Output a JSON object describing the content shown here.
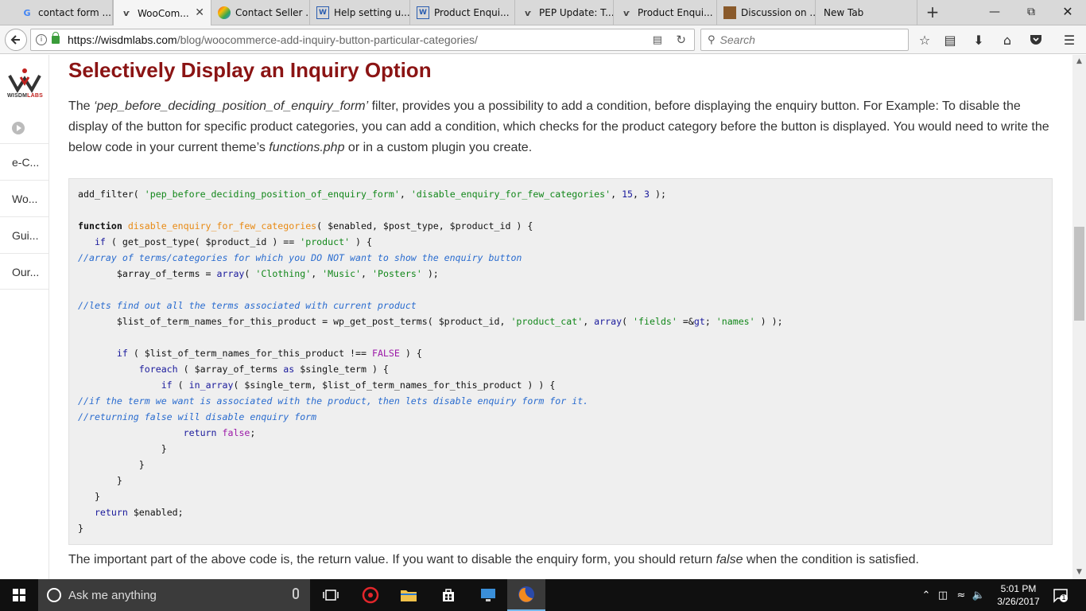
{
  "browser": {
    "tabs": [
      {
        "title": "contact form ...",
        "favicon": "google-icon"
      },
      {
        "title": "WooCom...",
        "favicon": "wisdmlabs-icon",
        "active": true
      },
      {
        "title": "Contact Seller ...",
        "favicon": "multicolor-icon"
      },
      {
        "title": "Help setting u...",
        "favicon": "wp-icon"
      },
      {
        "title": "Product Enqui...",
        "favicon": "wp-icon"
      },
      {
        "title": "PEP Update: T...",
        "favicon": "wisdmlabs-icon"
      },
      {
        "title": "Product Enqui...",
        "favicon": "wisdmlabs-icon"
      },
      {
        "title": "Discussion on ...",
        "favicon": "photo-icon"
      },
      {
        "title": "New Tab",
        "favicon": ""
      }
    ],
    "url_host": "https://wisdmlabs.com",
    "url_path": "/blog/woocommerce-add-inquiry-button-particular-categories/",
    "search_placeholder": "Search",
    "new_tab_symbol": "+",
    "close_symbol": "✕"
  },
  "site": {
    "logo_text_1": "WISDM",
    "logo_text_2": "LABS",
    "sidebar_items": [
      "e-C...",
      "Wo...",
      "Gui...",
      "Our..."
    ]
  },
  "article": {
    "heading": "Selectively Display an Inquiry Option",
    "para1_a": "The ",
    "para1_filter": "‘pep_before_deciding_position_of_enquiry_form’",
    "para1_b": " filter, provides you a possibility to add a condition, before displaying the enquiry button. For Example: To disable the display of the button for specific product categories, you can add a condition, which checks for the product category before the button is displayed. You would need to write the below code in your current theme’s ",
    "para1_file": "functions.php",
    "para1_c": " or in a custom plugin you create.",
    "para2_a": "The important part of the above code is, the return value. If you want to disable the enquiry form, you should return ",
    "para2_em": "false",
    "para2_b": " when the condition is satisfied."
  },
  "taskbar": {
    "search_placeholder": "Ask me anything",
    "time": "5:01 PM",
    "date": "3/26/2017",
    "notification_count": "1"
  }
}
